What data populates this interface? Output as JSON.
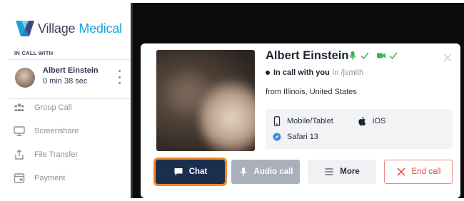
{
  "brand": {
    "name_part1": "Village",
    "name_part2": "Medical"
  },
  "sidebar": {
    "in_call_label": "IN CALL WITH",
    "participant": {
      "name": "Albert Einstein",
      "duration": "0 min 38 sec"
    },
    "items": [
      {
        "label": "Group Call",
        "icon": "group-icon"
      },
      {
        "label": "Screenshare",
        "icon": "monitor-icon"
      },
      {
        "label": "File Transfer",
        "icon": "upload-icon"
      },
      {
        "label": "Payment",
        "icon": "payment-icon"
      }
    ]
  },
  "card": {
    "name": "Albert Einstein",
    "status_bold": "In call with you",
    "status_user": "in /jsmith",
    "location": "from Illinois, United States",
    "device": {
      "type": "Mobile/Tablet",
      "os": "iOS",
      "browser": "Safari 13"
    },
    "buttons": {
      "chat": "Chat",
      "audio": "Audio call",
      "more": "More",
      "end": "End call"
    }
  },
  "colors": {
    "accent_orange": "#f08a26",
    "chat_bg": "#1c2e4e",
    "status_green": "#3bb54a",
    "end_red": "#e2463c",
    "brand_blue": "#1aa3d9"
  }
}
